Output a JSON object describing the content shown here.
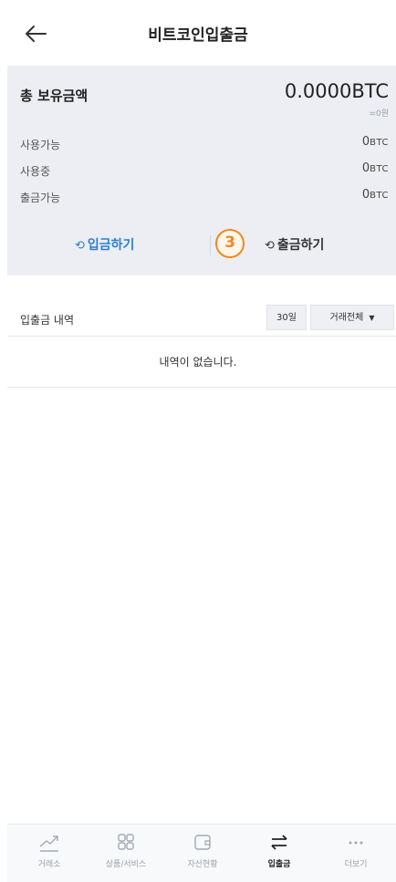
{
  "header": {
    "title": "비트코인입출금"
  },
  "summary": {
    "total_label": "총 보유금액",
    "total_value": "0.0000BTC",
    "krw_value": "=0원",
    "rows": [
      {
        "label": "사용가능",
        "value": "0",
        "unit": "BTC"
      },
      {
        "label": "사용중",
        "value": "0",
        "unit": "BTC"
      },
      {
        "label": "출금가능",
        "value": "0",
        "unit": "BTC"
      }
    ]
  },
  "actions": {
    "deposit_label": "입금하기",
    "withdraw_label": "출금하기",
    "step_badge": "3"
  },
  "history": {
    "label": "입출금 내역",
    "period_filter": "30일",
    "type_filter": "거래전체",
    "empty_message": "내역이 없습니다."
  },
  "tabbar": {
    "items": [
      {
        "label": "거래소",
        "icon": "chart-line-icon"
      },
      {
        "label": "상품/서비스",
        "icon": "grid-icon"
      },
      {
        "label": "자산현황",
        "icon": "wallet-icon"
      },
      {
        "label": "입출금",
        "icon": "transfer-arrows-icon",
        "active": true
      },
      {
        "label": "더보기",
        "icon": "more-dots-icon"
      }
    ]
  },
  "colors": {
    "accent_blue": "#2b7fd8",
    "badge_orange": "#f08a1a",
    "summary_bg": "#eceef3"
  }
}
